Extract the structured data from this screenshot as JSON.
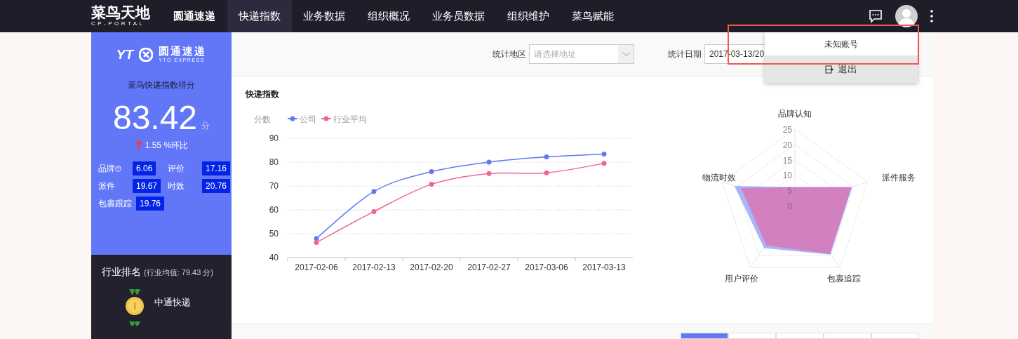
{
  "nav": {
    "logo": "菜鸟天地",
    "logo_sub": "CP-PORTAL",
    "company": "圆通速递",
    "items": [
      {
        "label": "快递指数",
        "selected": true
      },
      {
        "label": "业务数据",
        "selected": false
      },
      {
        "label": "组织概况",
        "selected": false
      },
      {
        "label": "业务员数据",
        "selected": false
      },
      {
        "label": "组织维护",
        "selected": false
      },
      {
        "label": "菜鸟赋能",
        "selected": false
      }
    ]
  },
  "account_menu": {
    "items": [
      {
        "label": "未知账号",
        "kind": "name"
      },
      {
        "label": "退出",
        "kind": "logout"
      }
    ]
  },
  "sidebar": {
    "brand": "YT",
    "brand_name": "圆通速递",
    "brand_sub": "YTO EXPRESS",
    "score_title": "菜鸟快递指数得分",
    "score": "83.42",
    "score_unit": "分",
    "change": "1.55 %环比",
    "metrics": [
      {
        "label": "品牌",
        "help": true,
        "value": "6.06"
      },
      {
        "label": "评价",
        "value": "17.16"
      },
      {
        "label": "派件",
        "value": "19.67"
      },
      {
        "label": "时效",
        "value": "20.76"
      },
      {
        "label": "包裹跟踪",
        "value": "19.76"
      }
    ],
    "ranking_title": "行业排名",
    "ranking_avg": "(行业均值: 79.43 分)",
    "ranking": [
      {
        "name": "中通快递"
      }
    ]
  },
  "filters": {
    "region_label": "统计地区",
    "region_placeholder": "请选择地址",
    "date_label": "统计日期",
    "date_value": "2017-03-13/20"
  },
  "index_card": {
    "title": "快递指数",
    "chart_data": {
      "type": "line",
      "ylabel": "分数",
      "grid": true,
      "legend": "top-left",
      "categories": [
        "2017-02-06",
        "2017-02-13",
        "2017-02-20",
        "2017-02-27",
        "2017-03-06",
        "2017-03-13"
      ],
      "ylim": [
        40,
        90
      ],
      "yticks": [
        40,
        50,
        60,
        70,
        80,
        90
      ],
      "series": [
        {
          "name": "公司",
          "color": "#6478f5",
          "marker": "circle",
          "values": [
            48,
            67.7,
            76,
            80,
            82.2,
            83.4
          ]
        },
        {
          "name": "行业平均",
          "color": "#f0629a",
          "marker": "circle",
          "values": [
            46.3,
            59.3,
            70.7,
            75.2,
            75.5,
            79.5
          ]
        }
      ]
    },
    "radar": {
      "axes": [
        "品牌认知",
        "派件服务",
        "包裹追踪",
        "用户评价",
        "物流时效"
      ],
      "ticks": [
        "25",
        "20",
        "15",
        "10",
        "5",
        "0"
      ]
    }
  },
  "bottom_tabs": [
    {
      "selected": true
    },
    {
      "selected": false
    },
    {
      "selected": false
    },
    {
      "selected": false
    },
    {
      "selected": false
    }
  ]
}
